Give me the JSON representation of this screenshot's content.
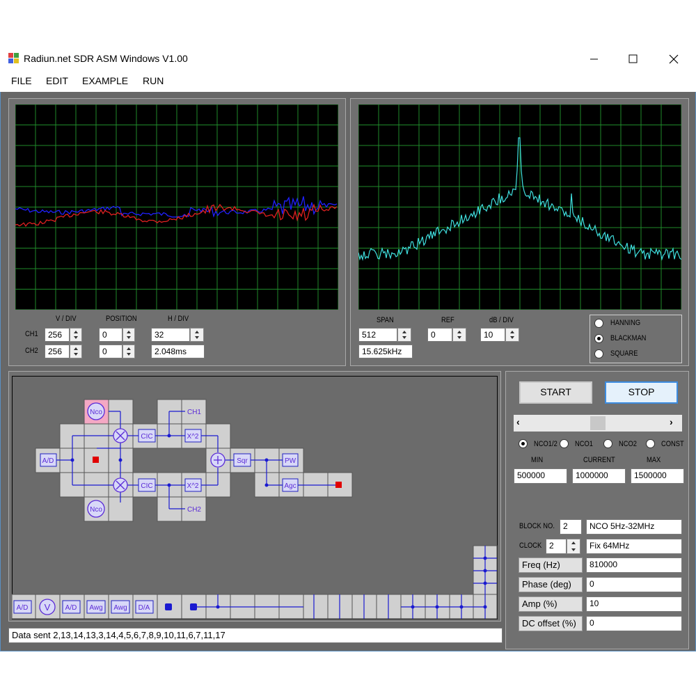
{
  "app": {
    "title": "Radiun.net  SDR ASM Windows V1.00"
  },
  "menu": [
    "FILE",
    "EDIT",
    "EXAMPLE",
    "RUN"
  ],
  "osc": {
    "headers": {
      "vdiv": "V / DIV",
      "position": "POSITION",
      "hdiv": "H / DIV"
    },
    "ch1": {
      "label": "CH1",
      "vdiv": "256",
      "position": "0"
    },
    "ch2": {
      "label": "CH2",
      "vdiv": "256",
      "position": "0"
    },
    "hdiv": "32",
    "time": "2.048ms",
    "colors": {
      "ch1": "#2020ff",
      "ch2": "#e02020",
      "grid": "#1f8a2a"
    }
  },
  "spectrum": {
    "headers": {
      "span": "SPAN",
      "ref": "REF",
      "dbdiv": "dB / DIV"
    },
    "span": "512",
    "span_freq": "15.625kHz",
    "ref": "0",
    "dbdiv": "10",
    "window_options": [
      "HANNING",
      "BLACKMAN",
      "SQUARE"
    ],
    "window_selected": "BLACKMAN",
    "colors": {
      "trace": "#40e0e0"
    }
  },
  "control": {
    "start": "START",
    "stop": "STOP",
    "nco_options": [
      "NCO1/2",
      "NCO1",
      "NCO2",
      "CONST"
    ],
    "nco_selected": "NCO1/2",
    "min_label": "MIN",
    "current_label": "CURRENT",
    "max_label": "MAX",
    "min": "500000",
    "current": "1000000",
    "max": "1500000",
    "block_label": "BLOCK NO.",
    "block_no": "2",
    "block_name": "NCO 5Hz-32MHz",
    "clock_label": "CLOCK",
    "clock": "2",
    "clock_desc": "Fix 64MHz",
    "params": [
      {
        "label": "Freq (Hz)",
        "value": "810000"
      },
      {
        "label": "Phase (deg)",
        "value": "0"
      },
      {
        "label": "Amp (%)",
        "value": "10"
      },
      {
        "label": "DC offset (%)",
        "value": "0"
      }
    ]
  },
  "diagram": {
    "blocks": {
      "nco": "Nco",
      "cic": "CIC",
      "x2": "X^2",
      "ad": "A/D",
      "sqr": "Sqr",
      "pw": "PW",
      "agc": "Agc",
      "ch1": "CH1",
      "ch2": "CH2"
    },
    "palette": [
      "A/D",
      "V",
      "A/D",
      "Awg",
      "Awg",
      "D/A"
    ]
  },
  "status": {
    "text": "Data sent  2,13,14,13,3,14,4,5,6,7,8,9,10,11,6,7,11,17"
  }
}
